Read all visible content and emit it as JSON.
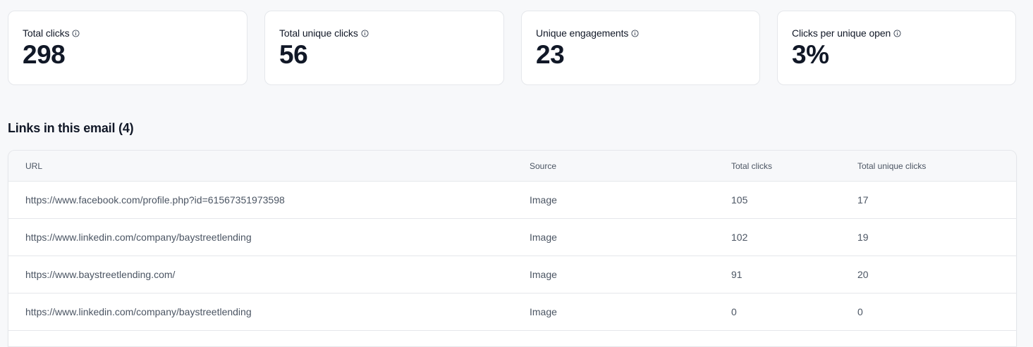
{
  "stats": [
    {
      "label": "Total clicks",
      "value": "298"
    },
    {
      "label": "Total unique clicks",
      "value": "56"
    },
    {
      "label": "Unique engagements",
      "value": "23"
    },
    {
      "label": "Clicks per unique open",
      "value": "3%"
    }
  ],
  "links_section": {
    "title": "Links in this email (4)",
    "columns": {
      "url": "URL",
      "source": "Source",
      "total_clicks": "Total clicks",
      "total_unique_clicks": "Total unique clicks"
    },
    "rows": [
      {
        "url": "https://www.facebook.com/profile.php?id=61567351973598",
        "source": "Image",
        "total_clicks": "105",
        "total_unique_clicks": "17"
      },
      {
        "url": "https://www.linkedin.com/company/baystreetlending",
        "source": "Image",
        "total_clicks": "102",
        "total_unique_clicks": "19"
      },
      {
        "url": "https://www.baystreetlending.com/",
        "source": "Image",
        "total_clicks": "91",
        "total_unique_clicks": "20"
      },
      {
        "url": "https://www.linkedin.com/company/baystreetlending",
        "source": "Image",
        "total_clicks": "0",
        "total_unique_clicks": "0"
      }
    ]
  },
  "icons": {
    "info": "info-icon"
  }
}
